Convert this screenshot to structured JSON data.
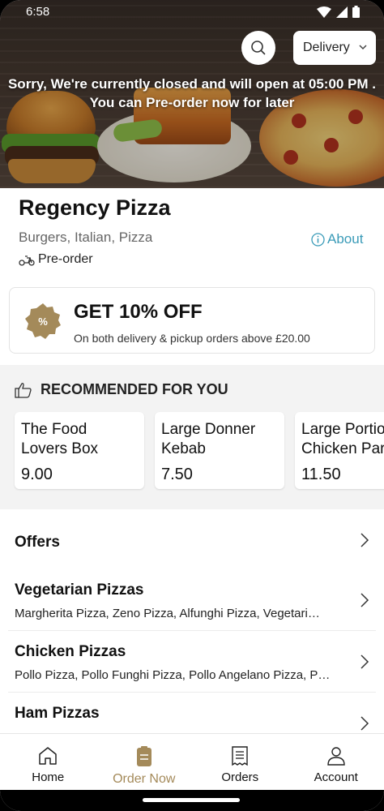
{
  "status_bar": {
    "time": "6:58"
  },
  "header": {
    "closed_message_line1": "Sorry, We're currently closed and will open at 05:00 PM .",
    "closed_message_line2": "You can Pre-order now for later",
    "delivery_select": "Delivery"
  },
  "restaurant": {
    "name": "Regency Pizza",
    "cuisines": "Burgers, Italian, Pizza",
    "preorder_label": "Pre-order",
    "about_label": "About"
  },
  "offer": {
    "title": "GET 10% OFF",
    "subtitle": "On both delivery & pickup orders above £20.00"
  },
  "recommended": {
    "heading": "RECOMMENDED FOR YOU",
    "items": [
      {
        "name_line1": "The Food",
        "name_line2": "Lovers Box",
        "price": "9.00"
      },
      {
        "name_line1": "Large Donner",
        "name_line2": "Kebab",
        "price": "7.50"
      },
      {
        "name_line1": "Large Portio",
        "name_line2": "Chicken Par",
        "price": "11.50"
      }
    ]
  },
  "menu": [
    {
      "title": "Offers",
      "desc": ""
    },
    {
      "title": "Vegetarian Pizzas",
      "desc": "Margherita Pizza, Zeno Pizza, Alfunghi Pizza, Vegetari…"
    },
    {
      "title": "Chicken Pizzas",
      "desc": "Pollo Pizza, Pollo Funghi Pizza, Pollo Angelano Pizza, P…"
    },
    {
      "title": "Ham Pizzas",
      "desc": ""
    }
  ],
  "bottom_nav": [
    {
      "label": "Home",
      "icon": "home-icon"
    },
    {
      "label": "Order Now",
      "icon": "order-icon",
      "active": true
    },
    {
      "label": "Orders",
      "icon": "receipt-icon"
    },
    {
      "label": "Account",
      "icon": "account-icon"
    }
  ],
  "colors": {
    "accent": "#a48a5a",
    "link": "#3a9bb8",
    "badge": "#a48a5a"
  }
}
